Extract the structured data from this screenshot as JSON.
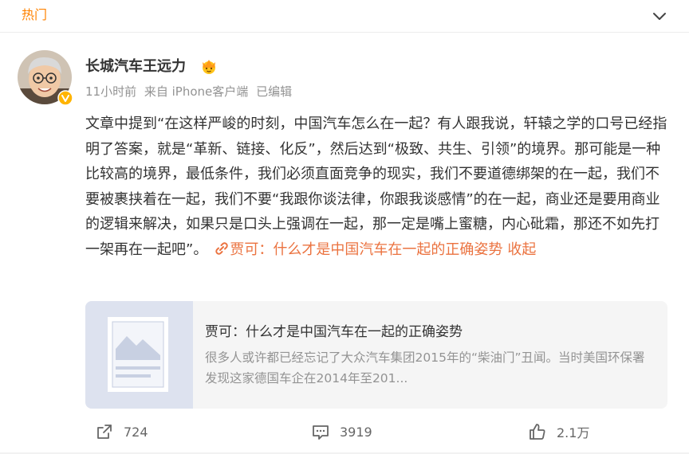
{
  "header": {
    "section_label": "热门",
    "collapse_icon": "chevron-down-icon"
  },
  "post": {
    "author": "长城汽车王远力",
    "author_badge_icon": "crown-icon",
    "verified_icon": "verified-badge-icon",
    "time": "11小时前",
    "source": "来自 iPhone客户端",
    "edited": "已编辑",
    "text": "文章中提到“在这样严峻的时刻，中国汽车怎么在一起？有人跟我说，轩辕之学的口号已经指明了答案，就是“革新、链接、化反”，然后达到“极致、共生、引领”的境界。那可能是一种比较高的境界，最低条件，我们必须直面竞争的现实，我们不要道德绑架的在一起，我们不要被裹挟着在一起，我们不要“我跟你谈法律，你跟我谈感情”的在一起，商业还是要用商业的逻辑来解决，如果只是口头上强调在一起，那一定是嘴上蜜糖，内心砒霜，那还不如先打一架再在一起吧”。",
    "link_text": "贾可：什么才是中国汽车在一起的正确姿势",
    "link_icon": "link-icon",
    "collapse_text": "收起"
  },
  "article_card": {
    "title": "贾可：什么才是中国汽车在一起的正确姿势",
    "description": "很多人或许都已经忘记了大众汽车集团2015年的“柴油门”丑闻。当时美国环保署发现这家德国车企在2014年至201...",
    "thumbnail_icon": "article-placeholder-icon"
  },
  "actions": {
    "repost_count": "724",
    "comment_count": "3919",
    "like_count": "2.1万"
  },
  "colors": {
    "accent": "#eb7340",
    "hot": "#ff8200",
    "text": "#333333",
    "meta": "#939393"
  }
}
